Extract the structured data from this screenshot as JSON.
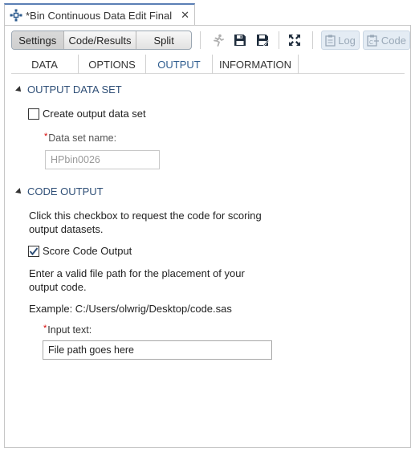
{
  "window": {
    "tab_title": "*Bin Continuous Data Edit Final",
    "close_glyph": "✕"
  },
  "toolbar": {
    "view_modes": [
      "Settings",
      "Code/Results",
      "Split"
    ],
    "selected_view_mode": "Settings",
    "icons": [
      "run-icon",
      "save-icon",
      "save-as-icon",
      "maximize-icon"
    ],
    "log_label": "Log",
    "code_label": "Code"
  },
  "tabs": [
    "DATA",
    "OPTIONS",
    "OUTPUT",
    "INFORMATION"
  ],
  "active_tab": "OUTPUT",
  "output_data_set": {
    "heading": "OUTPUT DATA SET",
    "create_checkbox_label": "Create output data set",
    "create_checked": false,
    "dataset_name_label": "Data set name:",
    "dataset_name_value": "HPbin0026"
  },
  "code_output": {
    "heading": "CODE OUTPUT",
    "instruction_line1": "Click this checkbox to request the code for scoring",
    "instruction_line2": "output datasets.",
    "score_checkbox_label": "Score Code Output",
    "score_checked": true,
    "path_instruction_line1": "Enter a valid file path for the placement of your",
    "path_instruction_line2": "output code.",
    "example_text": "Example: C:/Users/olwrig/Desktop/code.sas",
    "input_label": "Input text:",
    "input_value": "File path goes here"
  },
  "colors": {
    "accent": "#2f5d8f",
    "section_heading": "#2f4f77",
    "required": "#d40000",
    "disabled_button_bg": "#e4ecf4"
  }
}
